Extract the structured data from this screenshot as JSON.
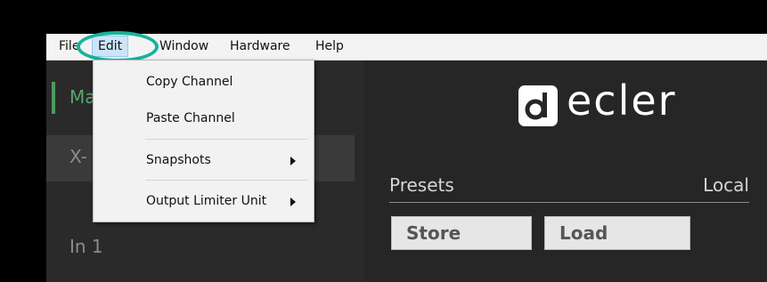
{
  "menubar": {
    "items": [
      {
        "label": "File"
      },
      {
        "label": "Edit"
      },
      {
        "label": "Window"
      },
      {
        "label": "Hardware"
      },
      {
        "label": "Help"
      }
    ]
  },
  "edit_menu": {
    "items": [
      {
        "label": "Copy Channel",
        "has_submenu": false
      },
      {
        "label": "Paste Channel",
        "has_submenu": false
      },
      {
        "label": "Snapshots",
        "has_submenu": true
      },
      {
        "label": "Output Limiter Unit",
        "has_submenu": true
      }
    ]
  },
  "left_panel": {
    "partial_top_label": "Ma",
    "partial_selected_label": "X-",
    "input_label": "In 1"
  },
  "logo": {
    "text": "ecler",
    "icon": "ecler-logo-icon"
  },
  "presets": {
    "label": "Presets",
    "location": "Local",
    "store_label": "Store",
    "load_label": "Load"
  },
  "colors": {
    "highlight_ring": "#18b29a",
    "accent": "#4e9b5e",
    "menu_bg": "#f3f3f3",
    "panel_bg": "#2a2a2a"
  }
}
